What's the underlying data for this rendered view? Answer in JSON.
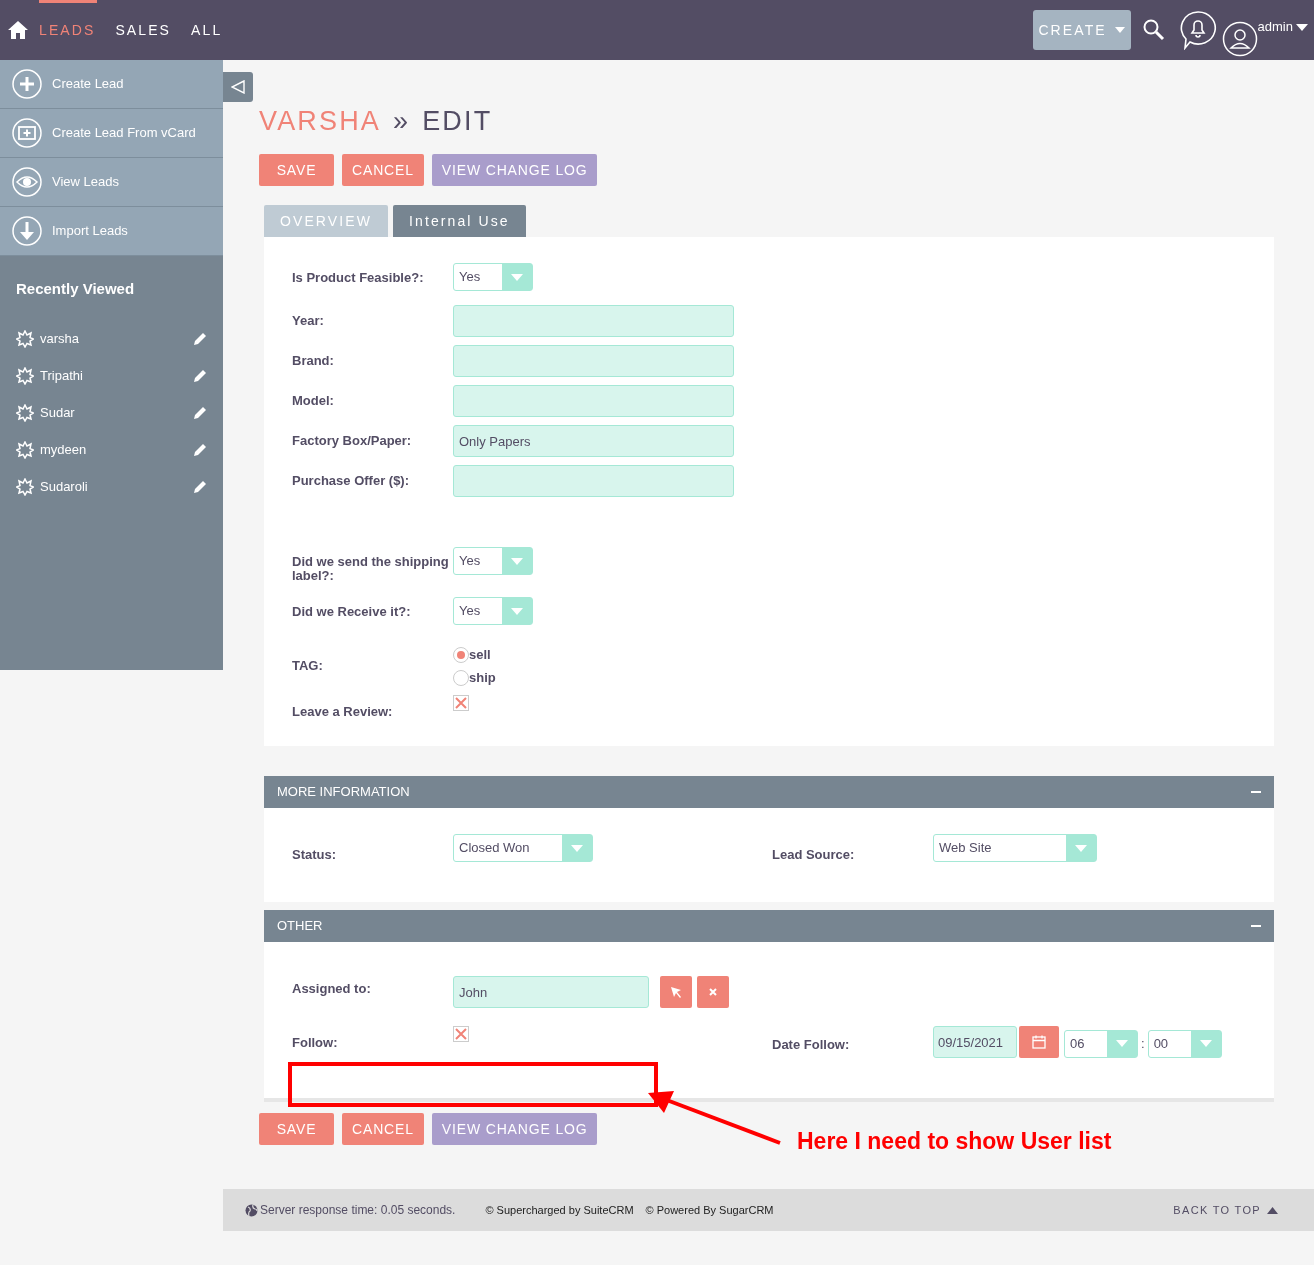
{
  "top_nav": {
    "items": [
      {
        "label": "LEADS",
        "selected": true
      },
      {
        "label": "SALES",
        "selected": false
      },
      {
        "label": "ALL",
        "selected": false
      }
    ],
    "create_button": "CREATE",
    "user": "admin"
  },
  "sidebar": {
    "actions": [
      {
        "label": "Create Lead",
        "kind": "create"
      },
      {
        "label": "Create Lead From vCard",
        "kind": "vcard"
      },
      {
        "label": "View Leads",
        "kind": "view"
      },
      {
        "label": "Import Leads",
        "kind": "import"
      }
    ],
    "recently_viewed_title": "Recently Viewed",
    "recently_viewed": [
      "varsha",
      "Tripathi",
      "Sudar",
      "mydeen",
      "Sudaroli"
    ]
  },
  "page_title": {
    "record": "VARSHA",
    "separator": "»",
    "action": "EDIT"
  },
  "buttons": [
    "SAVE",
    "CANCEL",
    "VIEW CHANGE LOG"
  ],
  "tabs": [
    {
      "label": "OVERVIEW",
      "selected": false
    },
    {
      "label": "Internal Use",
      "selected": true
    }
  ],
  "field_groups": [
    [
      {
        "kind": "select",
        "label": "Is Product Feasible?:",
        "value": "Yes"
      },
      {
        "kind": "text",
        "label": "Year:"
      },
      {
        "kind": "text",
        "label": "Brand:"
      },
      {
        "kind": "text",
        "label": "Model:"
      },
      {
        "kind": "text",
        "label": "Factory Box/Paper:",
        "value": "Only Papers"
      },
      {
        "kind": "text",
        "label": "Purchase Offer ($):"
      }
    ],
    [
      {
        "kind": "select",
        "label": "Did we send the shipping label?:",
        "value": "Yes"
      },
      {
        "kind": "select",
        "label": "Did we Receive it?:",
        "value": "Yes"
      },
      {
        "kind": "radio",
        "label": "TAG:",
        "options": [
          {
            "label": "sell",
            "selected": true
          },
          {
            "label": "ship",
            "selected": false
          }
        ]
      },
      {
        "kind": "checkbox",
        "label": "Leave a Review:",
        "checked": true
      }
    ]
  ],
  "panels": [
    {
      "title": "MORE INFORMATION",
      "expanded": true,
      "rows": [
        [
          {
            "kind": "select",
            "label": "Status:",
            "value": "Closed Won"
          },
          {
            "kind": "select",
            "label": "Lead Source:",
            "value": "Web Site"
          }
        ]
      ]
    },
    {
      "title": "OTHER",
      "expanded": true,
      "rows": [
        [
          {
            "kind": "relate",
            "label": "Assigned to:",
            "value": "John"
          }
        ],
        [
          {
            "kind": "checkbox",
            "label": "Follow:",
            "checked": true
          },
          {
            "kind": "datetime",
            "label": "Date Follow:",
            "date": "09/15/2021",
            "hour": "06",
            "separator": ":",
            "minute": "00"
          }
        ]
      ]
    }
  ],
  "bottom_buttons": [
    "SAVE",
    "CANCEL",
    "VIEW CHANGE LOG"
  ],
  "annotation": {
    "text": "Here I need to show User list"
  },
  "footer": {
    "server_time": "Server response time: 0.05 seconds.",
    "credits": [
      "© Supercharged by SuiteCRM",
      "© Powered By SugarCRM"
    ],
    "back_to_top": "BACK TO TOP"
  }
}
